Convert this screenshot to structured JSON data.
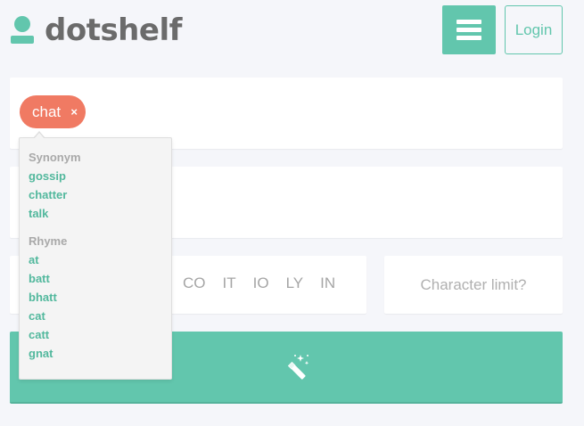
{
  "header": {
    "logo_text": "dotshelf",
    "login_label": "Login"
  },
  "keyword_chip": {
    "label": "chat",
    "remove_symbol": "×"
  },
  "suggestions": {
    "groups": [
      {
        "heading": "Synonym",
        "items": [
          "gossip",
          "chatter",
          "talk"
        ]
      },
      {
        "heading": "Rhyme",
        "items": [
          "at",
          "batt",
          "bhatt",
          "cat",
          "catt",
          "gnat"
        ]
      }
    ]
  },
  "tlds": [
    "CO",
    "IT",
    "IO",
    "LY",
    "IN"
  ],
  "character_limit": {
    "placeholder": "Character limit?"
  },
  "colors": {
    "accent": "#62c6ad",
    "chip": "#f07a63",
    "background": "#f5f6fa"
  },
  "icons": {
    "menu": "hamburger-icon",
    "generate": "magic-wand-icon",
    "logo": "person-icon"
  }
}
